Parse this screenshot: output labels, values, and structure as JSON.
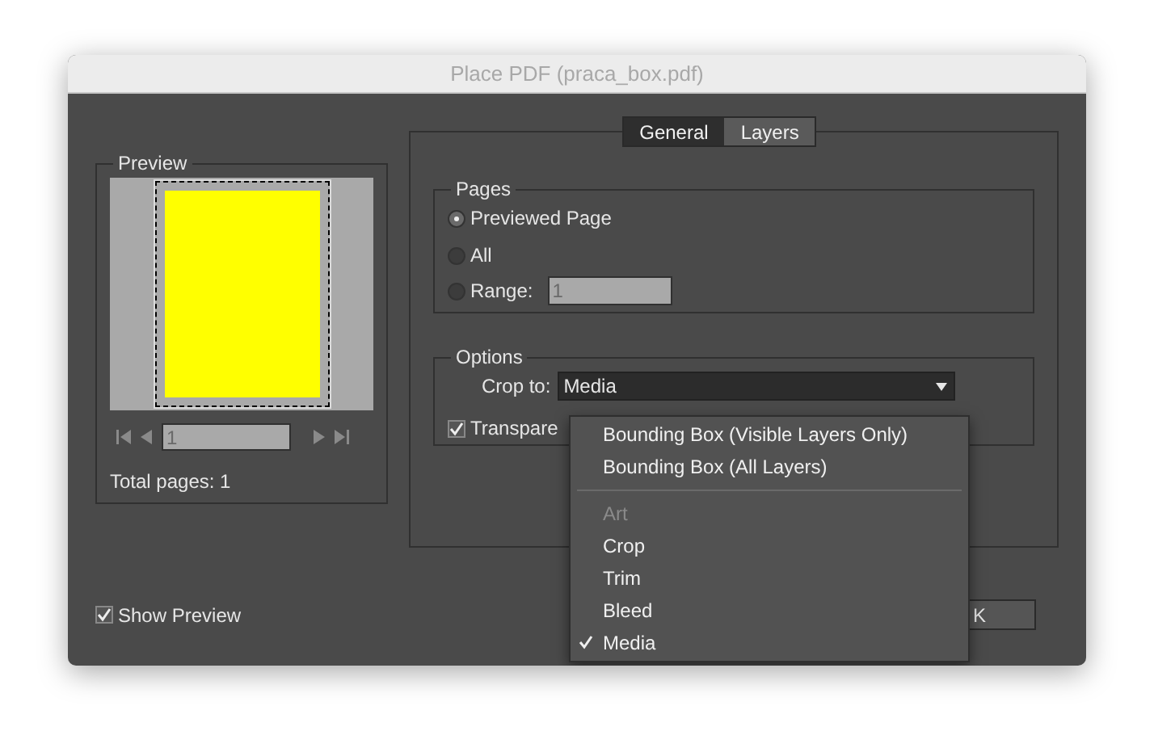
{
  "window": {
    "title": "Place PDF (praca_box.pdf)"
  },
  "preview": {
    "legend": "Preview",
    "page_field": "1",
    "total_pages": "Total pages: 1"
  },
  "tabs": [
    {
      "label": "General",
      "selected": true
    },
    {
      "label": "Layers",
      "selected": false
    }
  ],
  "pages": {
    "legend": "Pages",
    "options": [
      {
        "label": "Previewed Page",
        "selected": true
      },
      {
        "label": "All",
        "selected": false
      },
      {
        "label": "Range:",
        "selected": false
      }
    ],
    "range_value": "1"
  },
  "options": {
    "legend": "Options",
    "crop_label": "Crop to:",
    "crop_value": "Media",
    "transparent": {
      "label": "Transpare",
      "checked": true
    }
  },
  "crop_menu": [
    {
      "kind": "option",
      "label": "Bounding Box (Visible Layers Only)",
      "disabled": false,
      "selected": false
    },
    {
      "kind": "option",
      "label": "Bounding Box (All Layers)",
      "disabled": false,
      "selected": false
    },
    {
      "kind": "separator"
    },
    {
      "kind": "option",
      "label": "Art",
      "disabled": true,
      "selected": false
    },
    {
      "kind": "option",
      "label": "Crop",
      "disabled": false,
      "selected": false
    },
    {
      "kind": "option",
      "label": "Trim",
      "disabled": false,
      "selected": false
    },
    {
      "kind": "option",
      "label": "Bleed",
      "disabled": false,
      "selected": false
    },
    {
      "kind": "option",
      "label": "Media",
      "disabled": false,
      "selected": true
    }
  ],
  "show_preview": {
    "label": "Show Preview",
    "checked": true
  },
  "button": {
    "label": "K"
  }
}
